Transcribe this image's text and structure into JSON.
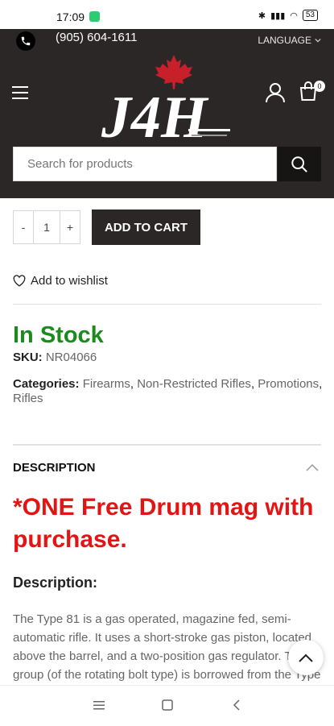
{
  "status": {
    "time": "17:09",
    "battery": "53"
  },
  "header": {
    "phone": "(905) 604-1611",
    "language": "LANGUAGE",
    "cart_count": "0",
    "logo_text": "J4H",
    "search_placeholder": "Search for products"
  },
  "product": {
    "qty_minus": "-",
    "qty_value": "1",
    "qty_plus": "+",
    "add_to_cart": "ADD TO CART",
    "wishlist": "Add to wishlist",
    "stock": "In Stock",
    "sku_label": "SKU:",
    "sku_value": "NR04066",
    "categories_label": "Categories:",
    "categories": [
      "Firearms",
      "Non-Restricted Rifles",
      "Promotions",
      "Rifles"
    ]
  },
  "description": {
    "tab_label": "DESCRIPTION",
    "promo": "*ONE Free Drum mag with purchase.",
    "heading": "Description:",
    "body": "The Type 81 is a gas operated, magazine fed, semi-automatic rifle. It uses a short-stroke gas piston, located above the barrel, and a two-position gas regulator. The group (of the rotating bolt type) is borrowed from the Type"
  },
  "colors": {
    "header_bg": "#2b2727",
    "stock_green": "#1c8a1c",
    "promo_red": "#e31414",
    "maple_red": "#c8202a"
  }
}
